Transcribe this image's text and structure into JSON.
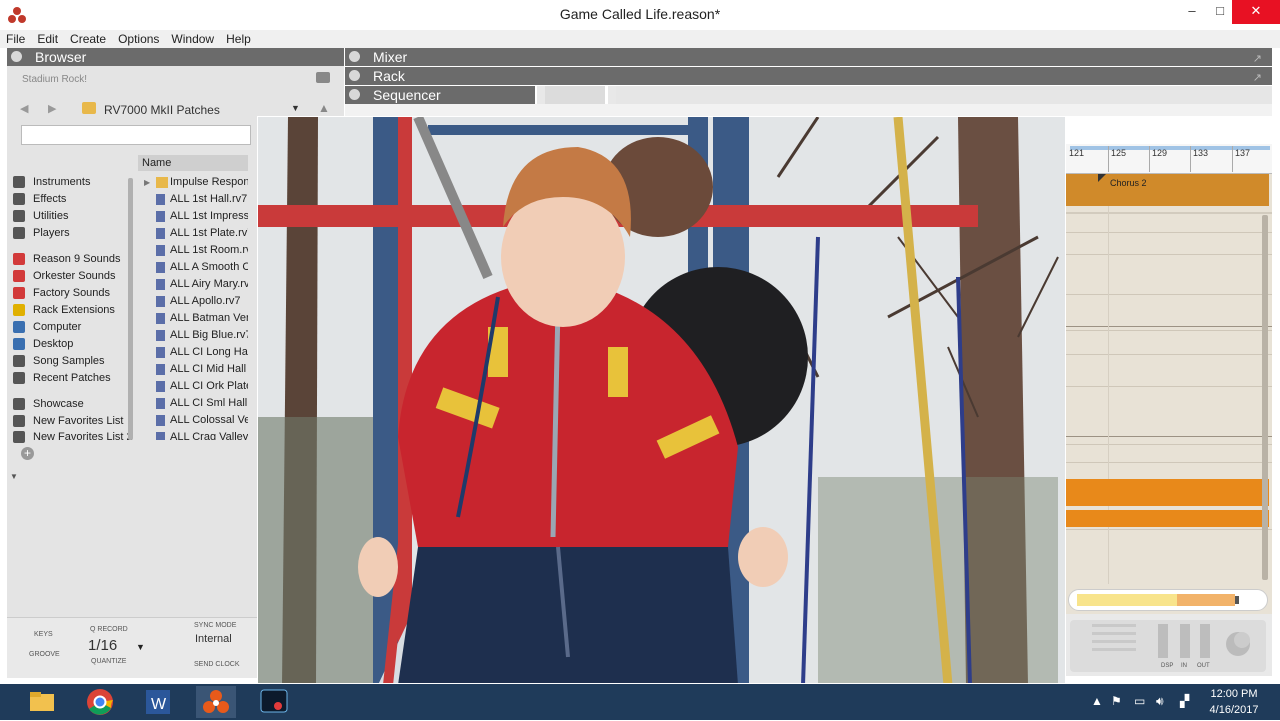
{
  "window": {
    "title": "Game Called Life.reason*",
    "minimize": "–",
    "maximize": "□",
    "close": "✕"
  },
  "menu": [
    "File",
    "Edit",
    "Create",
    "Options",
    "Window",
    "Help"
  ],
  "browser": {
    "header": "Browser",
    "location": "Stadium Rock!",
    "path": "RV7000 MkII Patches",
    "search_placeholder": "",
    "column_name": "Name",
    "sidebar": [
      {
        "label": "Instruments",
        "icon": "instruments-icon",
        "color": "#555555"
      },
      {
        "label": "Effects",
        "icon": "effects-icon",
        "color": "#555555"
      },
      {
        "label": "Utilities",
        "icon": "utilities-icon",
        "color": "#555555"
      },
      {
        "label": "Players",
        "icon": "players-icon",
        "color": "#555555"
      },
      {
        "label": "Reason 9 Sounds",
        "icon": "reason-sounds-icon",
        "color": "#d23a3a"
      },
      {
        "label": "Orkester Sounds",
        "icon": "orkester-sounds-icon",
        "color": "#d23a3a"
      },
      {
        "label": "Factory Sounds",
        "icon": "factory-sounds-icon",
        "color": "#d23a3a"
      },
      {
        "label": "Rack Extensions",
        "icon": "rack-extensions-icon",
        "color": "#e0b000"
      },
      {
        "label": "Computer",
        "icon": "computer-icon",
        "color": "#3a6fb0"
      },
      {
        "label": "Desktop",
        "icon": "desktop-icon",
        "color": "#3a6fb0"
      },
      {
        "label": "Song Samples",
        "icon": "song-samples-icon",
        "color": "#555555"
      },
      {
        "label": "Recent Patches",
        "icon": "recent-patches-icon",
        "color": "#555555"
      },
      {
        "label": "Showcase",
        "icon": "showcase-star-icon",
        "color": "#555555"
      },
      {
        "label": "New Favorites List",
        "icon": "favorites-star-icon",
        "color": "#555555"
      },
      {
        "label": "New Favorites List 2",
        "icon": "favorites-star-icon",
        "color": "#555555"
      }
    ],
    "files": [
      {
        "label": "Impulse Respon",
        "type": "folder"
      },
      {
        "label": "ALL 1st Hall.rv7",
        "type": "patch"
      },
      {
        "label": "ALL 1st Impress",
        "type": "patch"
      },
      {
        "label": "ALL 1st Plate.rv7",
        "type": "patch"
      },
      {
        "label": "ALL 1st Room.rv",
        "type": "patch"
      },
      {
        "label": "ALL A Smooth C",
        "type": "patch"
      },
      {
        "label": "ALL Airy Mary.rv",
        "type": "patch"
      },
      {
        "label": "ALL Apollo.rv7",
        "type": "patch"
      },
      {
        "label": "ALL Batman Ver",
        "type": "patch"
      },
      {
        "label": "ALL Big Blue.rv7",
        "type": "patch"
      },
      {
        "label": "ALL CI Long Ha",
        "type": "patch"
      },
      {
        "label": "ALL CI Mid Hall",
        "type": "patch"
      },
      {
        "label": "ALL CI Ork Plate",
        "type": "patch"
      },
      {
        "label": "ALL CI Sml Hall.",
        "type": "patch"
      },
      {
        "label": "ALL Colossal Ve",
        "type": "patch"
      },
      {
        "label": "ALL Crag Valley",
        "type": "patch"
      }
    ]
  },
  "panels": {
    "mixer": "Mixer",
    "rack": "Rack",
    "sequencer": "Sequencer"
  },
  "sequencer": {
    "ruler_ticks": [
      "121",
      "125",
      "129",
      "133",
      "137"
    ],
    "clip_label": "Chorus 2",
    "clip_color": "#d08a2a",
    "lane_color": "#e8891a"
  },
  "transport": {
    "keys": "KEYS",
    "groove": "GROOVE",
    "q_record": "Q RECORD",
    "quantize_value": "1/16",
    "quantize": "QUANTIZE",
    "sync_mode": "SYNC MODE",
    "sync_value": "Internal",
    "send_clock": "SEND CLOCK",
    "dsp": "DSP",
    "in": "IN",
    "out": "OUT"
  },
  "taskbar": {
    "apps": [
      {
        "name": "file-explorer-icon",
        "active": false
      },
      {
        "name": "chrome-icon",
        "active": false
      },
      {
        "name": "word-icon",
        "active": false
      },
      {
        "name": "reason-icon",
        "active": true
      },
      {
        "name": "screen-recorder-icon",
        "active": false
      }
    ],
    "time": "12:00 PM",
    "date": "4/16/2017"
  }
}
